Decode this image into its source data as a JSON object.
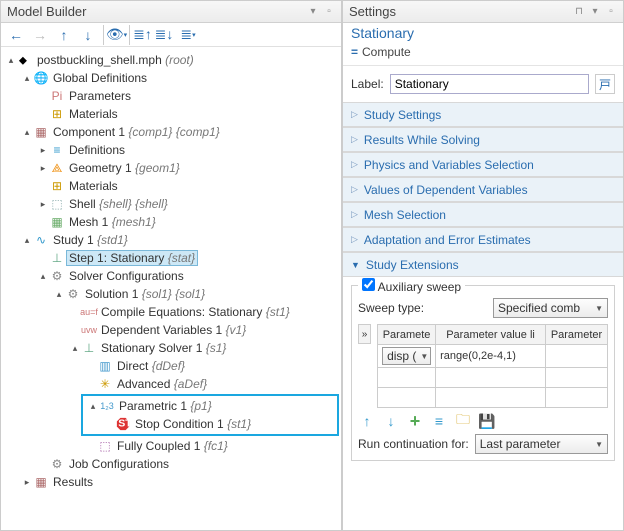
{
  "left": {
    "title": "Model Builder",
    "tree": {
      "root": "postbuckling_shell.mph",
      "root_suffix": "(root)",
      "global_defs": "Global Definitions",
      "parameters": "Parameters",
      "materials": "Materials",
      "component": "Component 1",
      "component_tags": "{comp1} {comp1}",
      "definitions": "Definitions",
      "geometry": "Geometry 1",
      "geometry_tag": "{geom1}",
      "materials2": "Materials",
      "shell": "Shell",
      "shell_tag": "{shell} {shell}",
      "mesh": "Mesh 1",
      "mesh_tag": "{mesh1}",
      "study": "Study 1",
      "study_tag": "{std1}",
      "step1": "Step 1: Stationary",
      "step1_tag": "{stat}",
      "solver_cfg": "Solver Configurations",
      "solution": "Solution 1",
      "solution_tag": "{sol1} {sol1}",
      "compile": "Compile Equations: Stationary",
      "compile_tag": "{st1}",
      "depvars": "Dependent Variables 1",
      "depvars_tag": "{v1}",
      "stat_solver": "Stationary Solver 1",
      "stat_solver_tag": "{s1}",
      "direct": "Direct",
      "direct_tag": "{dDef}",
      "advanced": "Advanced",
      "advanced_tag": "{aDef}",
      "parametric": "Parametric 1",
      "parametric_tag": "{p1}",
      "stop_cond": "Stop Condition 1",
      "stop_cond_tag": "{st1}",
      "fully_coupled": "Fully Coupled 1",
      "fully_coupled_tag": "{fc1}",
      "job_cfg": "Job Configurations",
      "results": "Results"
    }
  },
  "right": {
    "title": "Settings",
    "subheader": "Stationary",
    "compute": "Compute",
    "label_label": "Label:",
    "label_value": "Stationary",
    "sections": {
      "study_settings": "Study Settings",
      "results_while": "Results While Solving",
      "physics_vars": "Physics and Variables Selection",
      "dep_values": "Values of Dependent Variables",
      "mesh_sel": "Mesh Selection",
      "adapt_err": "Adaptation and Error Estimates",
      "study_ext": "Study Extensions"
    },
    "aux_sweep_label": "Auxiliary sweep",
    "sweep_type_label": "Sweep type:",
    "sweep_type_value": "Specified comb",
    "table": {
      "h1": "Paramete",
      "h2": "Parameter value li",
      "h3": "Parameter",
      "r1c1": "disp (",
      "r1c2": "range(0,2e-4,1)",
      "r1c3": ""
    },
    "run_cont_label": "Run continuation for:",
    "run_cont_value": "Last parameter"
  }
}
